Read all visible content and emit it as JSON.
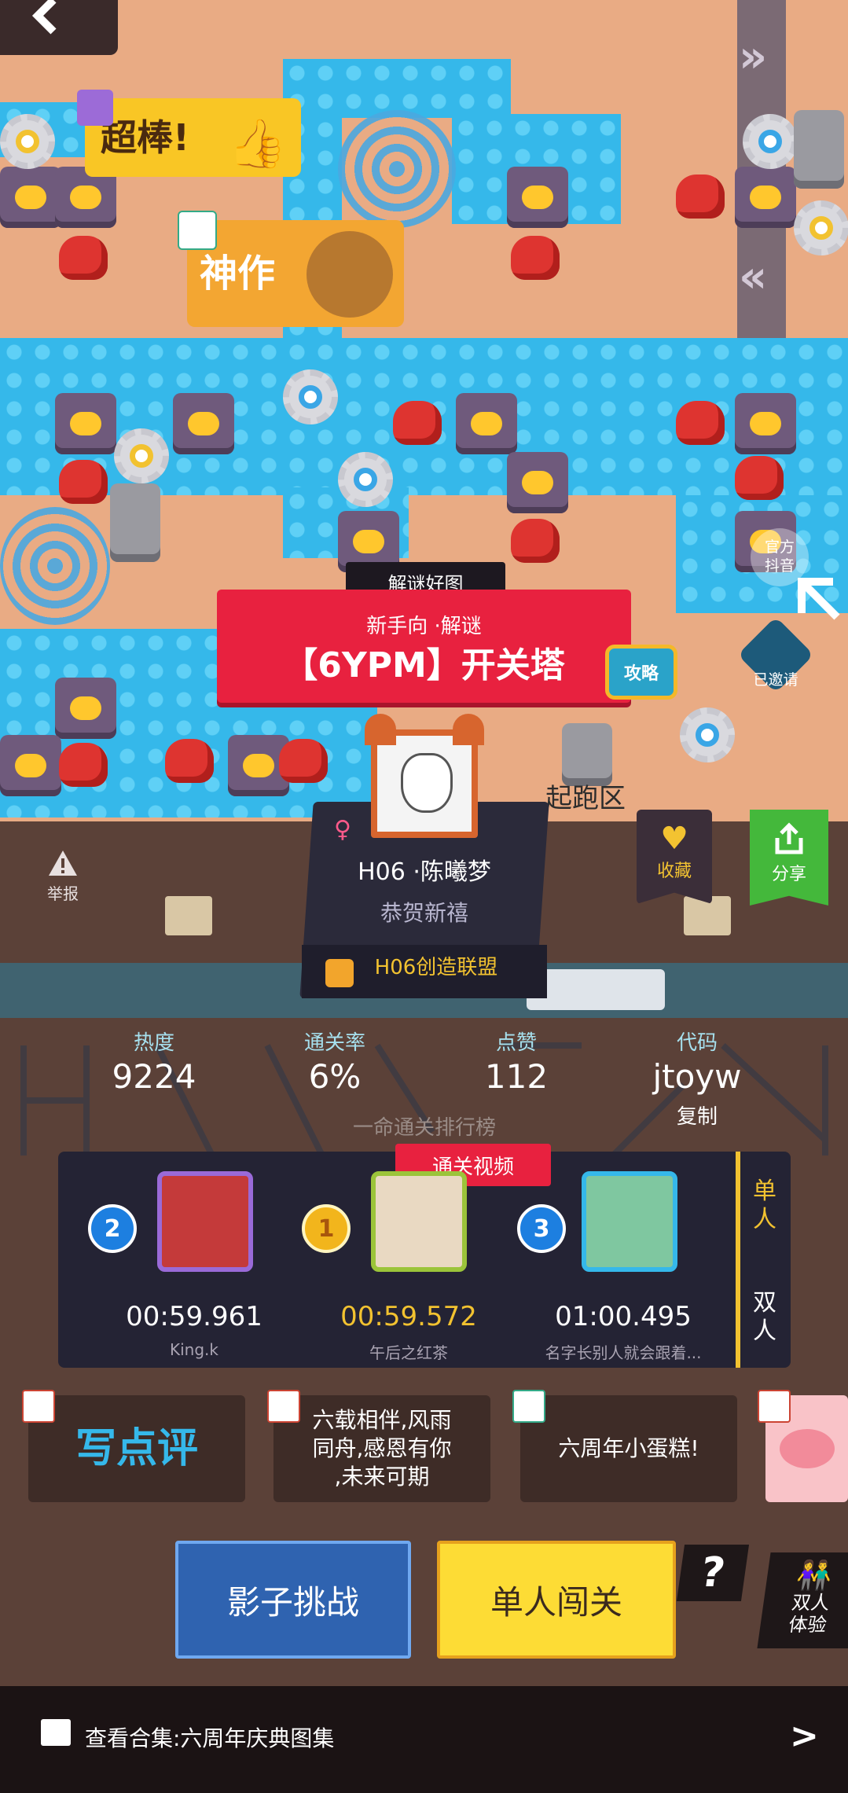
{
  "map": {
    "start_zone_label": "起跑区",
    "official_label": "官方\n抖音",
    "invited_label": "已邀请",
    "report_label": "举报"
  },
  "stickers": {
    "great": "超棒!",
    "masterpiece": "神作"
  },
  "level": {
    "tag": "解谜好图",
    "subtitle": "新手向 ·解谜",
    "title": "【6YPM】开关塔",
    "guide_label": "攻略",
    "favorite_label": "收藏",
    "share_label": "分享"
  },
  "author": {
    "gender_icon": "female-icon",
    "name": "H06 ·陈曦梦",
    "greeting": "恭贺新禧",
    "team": "H06创造联盟"
  },
  "stats": {
    "heat_label": "热度",
    "heat_value": "9224",
    "clear_rate_label": "通关率",
    "clear_rate_value": "6%",
    "likes_label": "点赞",
    "likes_value": "112",
    "code_label": "代码",
    "code_value": "jtoyw",
    "copy_label": "复制"
  },
  "ranking": {
    "title": "一命通关排行榜",
    "video_tag": "通关视频",
    "mode_single": "单\n人",
    "mode_double": "双\n人",
    "entries": [
      {
        "rank": "2",
        "time": "00:59.961",
        "name": "King.k"
      },
      {
        "rank": "1",
        "time": "00:59.572",
        "name": "午后之红茶"
      },
      {
        "rank": "3",
        "time": "01:00.495",
        "name": "名字长别人就会跟着..."
      }
    ]
  },
  "comments": {
    "write_label": "写点评",
    "items": [
      "六载相伴,风雨\n同舟,感恩有你\n,未来可期",
      "六周年小蛋糕!"
    ]
  },
  "buttons": {
    "shadow": "影子挑战",
    "single": "单人闯关",
    "help": "?",
    "duo": "双人\n体验"
  },
  "footer": {
    "collection": "查看合集:六周年庆典图集",
    "arrow": ">"
  },
  "colors": {
    "accent_red": "#e8213f",
    "track_blue": "#35b8ea",
    "gold": "#fddc35",
    "dark_panel": "#242334"
  }
}
